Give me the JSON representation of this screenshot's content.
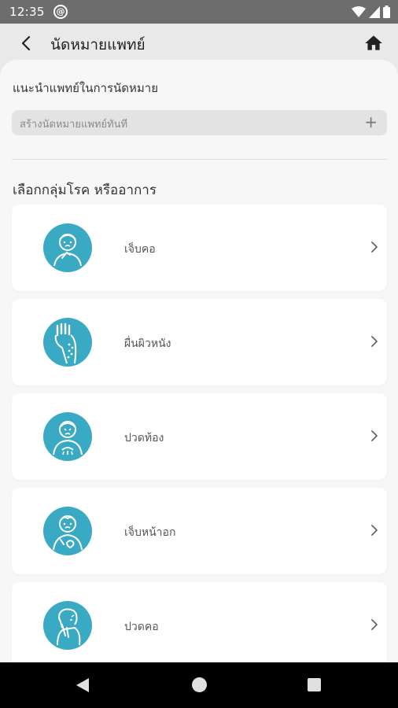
{
  "status_bar": {
    "time": "12:35",
    "notification_icon": "at-sign-icon"
  },
  "app_bar": {
    "title": "นัดหมายแพทย์"
  },
  "recommend": {
    "title": "แนะนำแพทย์ในการนัดหมาย",
    "quick_add_label": "สร้างนัดหมายแพทย์ทันที"
  },
  "symptoms": {
    "title": "เลือกกลุ่มโรค หรืออาการ",
    "items": [
      {
        "label": "เจ็บคอ",
        "icon": "sore-throat-icon"
      },
      {
        "label": "ผื่นผิวหนัง",
        "icon": "skin-rash-icon"
      },
      {
        "label": "ปวดท้อง",
        "icon": "stomachache-icon"
      },
      {
        "label": "เจ็บหน้าอก",
        "icon": "chest-pain-icon"
      },
      {
        "label": "ปวดคอ",
        "icon": "neck-pain-icon"
      }
    ]
  },
  "colors": {
    "icon_accent": "#3aa9c4",
    "sheet": "#f7f7f7",
    "status_bar": "#6d6d6d"
  }
}
